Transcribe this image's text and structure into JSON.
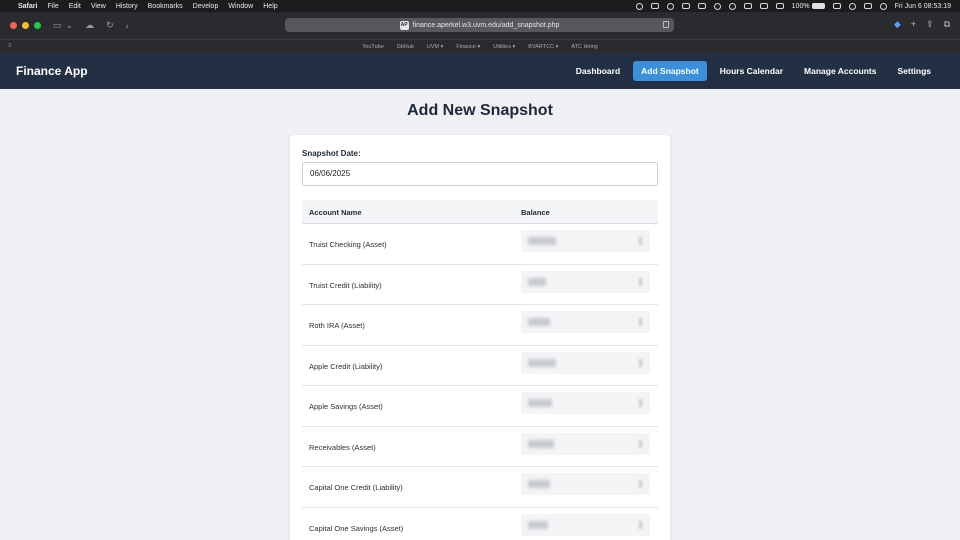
{
  "menubar": {
    "app_name": "Safari",
    "menus": [
      "File",
      "Edit",
      "View",
      "History",
      "Bookmarks",
      "Develop",
      "Window",
      "Help"
    ],
    "battery_percent": "100%",
    "datetime": "Fri Jun 6  08:53:19"
  },
  "browser": {
    "url": "finance.aperkel.w3.uvm.edu/add_snapshot.php",
    "favicon_text": "AP",
    "favorites": [
      "YouTube",
      "GitHub",
      "UVM ▾",
      "Finance ▾",
      "Utilities ▾",
      "BVARTCC ▾",
      "ATC Hiring"
    ]
  },
  "app": {
    "brand": "Finance App",
    "nav": [
      {
        "label": "Dashboard",
        "active": false
      },
      {
        "label": "Add Snapshot",
        "active": true
      },
      {
        "label": "Hours Calendar",
        "active": false
      },
      {
        "label": "Manage Accounts",
        "active": false
      },
      {
        "label": "Settings",
        "active": false
      }
    ],
    "accent_color": "#3c8fd9",
    "nav_bg_color": "#233044"
  },
  "page": {
    "title": "Add New Snapshot",
    "date_label": "Snapshot Date:",
    "date_value": "06/06/2025",
    "table": {
      "headers": [
        "Account Name",
        "Balance"
      ],
      "rows": [
        {
          "name": "Truist Checking (Asset)",
          "balance": "",
          "blurred": true
        },
        {
          "name": "Truist Credit (Liability)",
          "balance": "",
          "blurred": true
        },
        {
          "name": "Roth IRA (Asset)",
          "balance": "",
          "blurred": true
        },
        {
          "name": "Apple Credit (Liability)",
          "balance": "",
          "blurred": true
        },
        {
          "name": "Apple Savings (Asset)",
          "balance": "",
          "blurred": true
        },
        {
          "name": "Receivables (Asset)",
          "balance": "",
          "blurred": true
        },
        {
          "name": "Capital One Credit (Liability)",
          "balance": "",
          "blurred": true
        },
        {
          "name": "Capital One Savings (Asset)",
          "balance": "",
          "blurred": true
        }
      ]
    }
  }
}
